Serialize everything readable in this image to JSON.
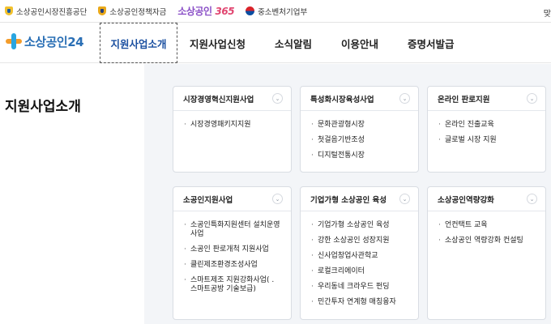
{
  "topbar": {
    "links": [
      {
        "label": "소상공인시장진흥공단",
        "icon": "semas-emblem-icon"
      },
      {
        "label": "소상공인정책자금",
        "icon": "policy-fund-emblem-icon"
      }
    ],
    "brand365_text": "소상공인",
    "brand365_num": "365",
    "ministry": "중소벤처기업부",
    "right_partial": "맞"
  },
  "header": {
    "logo_text": "소상공인",
    "logo_num": "24",
    "nav": [
      "지원사업소개",
      "지원사업신청",
      "소식알림",
      "이용안내",
      "증명서발급"
    ],
    "active_index": 0
  },
  "side": {
    "title": "지원사업소개"
  },
  "cards": [
    {
      "title": "시장경영혁신지원사업",
      "items": [
        "시장경영패키지지원"
      ]
    },
    {
      "title": "특성화시장육성사업",
      "items": [
        "문화관광형시장",
        "첫걸음기반조성",
        "디지털전통시장"
      ]
    },
    {
      "title": "온라인 판로지원",
      "items": [
        "온라인 진출교육",
        "글로벌 시장 지원"
      ]
    },
    {
      "title": "소공인지원사업",
      "items": [
        "소공인특화지원센터 설치운영사업",
        "소공인 판로개척 지원사업",
        "클린제조환경조성사업",
        "스마트제조 지원강화사업( . 스마트공방 기술보급)"
      ]
    },
    {
      "title": "기업가형 소상공인 육성",
      "items": [
        "기업가형 소상공인 육성",
        "강한 소상공인 성장지원",
        "신사업창업사관학교",
        "로컬크리에이터",
        "우리동네 크라우드 펀딩",
        "민간투자 연계형 매칭융자"
      ]
    },
    {
      "title": "소상공인역량강화",
      "items": [
        "언컨택트 교육",
        "소상공인 역량강화 컨설팅"
      ]
    }
  ],
  "colors": {
    "accent": "#1a4fa0",
    "content_bg": "#f3f5f8",
    "brand365": "#8a4fc7"
  }
}
